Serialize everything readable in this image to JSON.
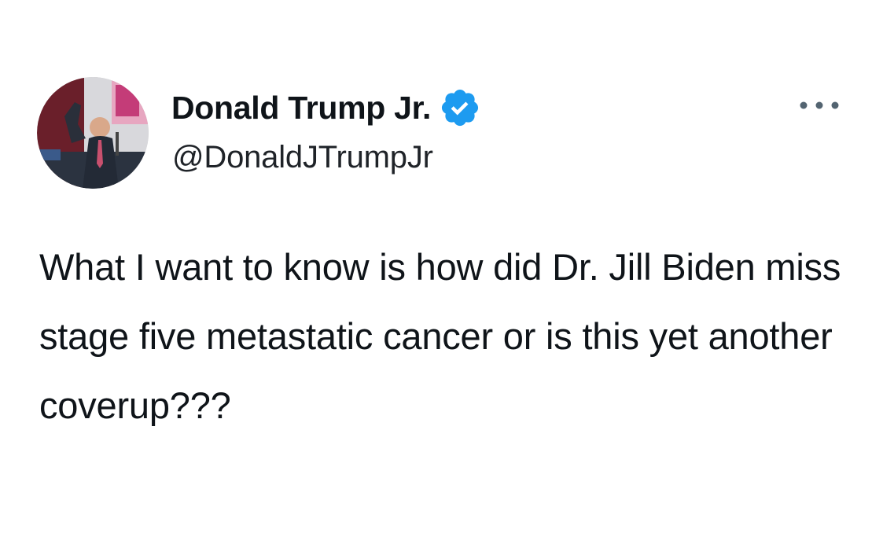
{
  "tweet": {
    "author": {
      "display_name": "Donald Trump Jr.",
      "handle": "@DonaldJTrumpJr",
      "verified": true,
      "verified_icon": "verified-badge-icon",
      "avatar_icon": "profile-photo"
    },
    "more_icon": "more-options-icon",
    "text": "What I want to know is how did Dr. Jill Biden miss stage five metastatic cancer or is this yet another coverup???"
  },
  "colors": {
    "background": "#ffffff",
    "text": "#0f1419",
    "verified_blue": "#1d9bf0"
  }
}
